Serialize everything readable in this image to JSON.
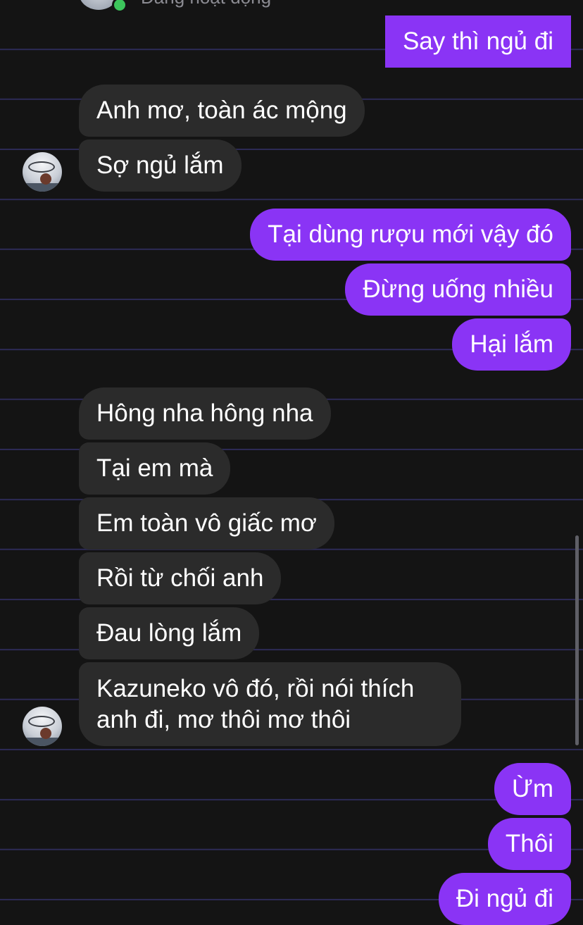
{
  "header": {
    "status": "Đang hoạt động"
  },
  "colors": {
    "outgoing": "#8a34f5",
    "incoming": "#2b2b2b",
    "online": "#3cc55b",
    "background": "#141414"
  },
  "messages": [
    {
      "from": "me",
      "text": "Say thì ngủ đi"
    },
    {
      "from": "them",
      "text": "Anh mơ, toàn ác mộng"
    },
    {
      "from": "them",
      "text": "Sợ ngủ lắm"
    },
    {
      "from": "me",
      "text": "Tại dùng rượu mới vậy đó"
    },
    {
      "from": "me",
      "text": "Đừng uống nhiều"
    },
    {
      "from": "me",
      "text": "Hại lắm"
    },
    {
      "from": "them",
      "text": "Hông nha hông nha"
    },
    {
      "from": "them",
      "text": "Tại em mà"
    },
    {
      "from": "them",
      "text": "Em toàn vô giấc mơ"
    },
    {
      "from": "them",
      "text": "Rồi từ chối anh"
    },
    {
      "from": "them",
      "text": "Đau lòng lắm"
    },
    {
      "from": "them",
      "text": "Kazuneko vô đó, rồi nói thích anh đi, mơ thôi mơ thôi"
    },
    {
      "from": "me",
      "text": "Ừm"
    },
    {
      "from": "me",
      "text": "Thôi"
    },
    {
      "from": "me",
      "text": "Đi ngủ đi"
    }
  ]
}
